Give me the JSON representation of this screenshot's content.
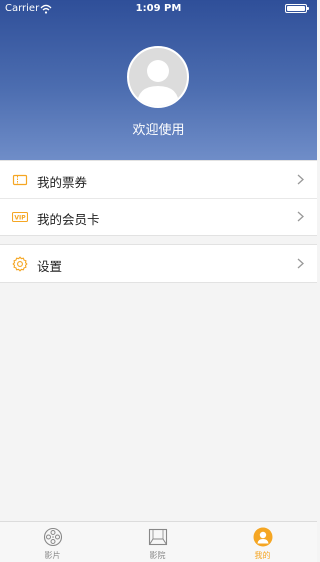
{
  "status_bar": {
    "carrier": "Carrier",
    "time": "1:09 PM"
  },
  "profile": {
    "welcome": "欢迎使用"
  },
  "menu": {
    "group1": [
      {
        "label": "我的票券",
        "icon": "ticket-icon"
      },
      {
        "label": "我的会员卡",
        "icon": "vip-card-icon",
        "badge": "VIP"
      }
    ],
    "group2": [
      {
        "label": "设置",
        "icon": "gear-icon"
      }
    ]
  },
  "tabbar": {
    "items": [
      {
        "label": "影片",
        "icon": "film-reel-icon"
      },
      {
        "label": "影院",
        "icon": "cinema-screen-icon"
      },
      {
        "label": "我的",
        "icon": "user-profile-icon",
        "active": true
      }
    ]
  },
  "colors": {
    "accent": "#f5a623",
    "header": "#3f5fa5"
  }
}
